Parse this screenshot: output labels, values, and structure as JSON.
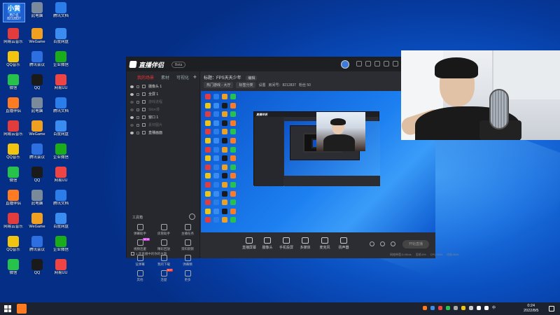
{
  "desktop": {
    "user_card": {
      "avatar": "小黄",
      "name": "用户名",
      "id": "8212837"
    },
    "icons": [
      {
        "label": "此电脑",
        "color": "#7b8a9a"
      },
      {
        "label": "腾讯文档",
        "color": "#2b7de9"
      },
      {
        "label": "网易云音乐",
        "color": "#e33c3c"
      },
      {
        "label": "WeGame",
        "color": "#f0a020"
      },
      {
        "label": "百度网盘",
        "color": "#3b8cf0"
      },
      {
        "label": "QQ音乐",
        "color": "#f1c40f"
      },
      {
        "label": "腾讯会议",
        "color": "#2d6fe0"
      },
      {
        "label": "企业微信",
        "color": "#1aad19"
      },
      {
        "label": "微信",
        "color": "#27c24c"
      },
      {
        "label": "QQ",
        "color": "#1a1a1a"
      },
      {
        "label": "网易UU",
        "color": "#e44"
      },
      {
        "label": "直播伴侣",
        "color": "#ff7b22"
      }
    ]
  },
  "app": {
    "logo_text": "直播伴侣",
    "beta_label": "Beta",
    "sidebar_tabs": [
      "我的场景",
      "素材",
      "可视化"
    ],
    "sources": [
      {
        "label": "摄像头 1",
        "dim": false
      },
      {
        "label": "全屏 1",
        "dim": false
      },
      {
        "label": "游戏进程",
        "dim": true
      },
      {
        "label": "Slice漫",
        "dim": true
      },
      {
        "label": "窗口 1",
        "dim": false
      },
      {
        "label": "素材图片",
        "dim": true
      },
      {
        "label": "直播画面",
        "dim": false
      }
    ],
    "tools_header": "工具箱",
    "tools": [
      {
        "label": "弹幕助手"
      },
      {
        "label": "房管助手"
      },
      {
        "label": "主播任务"
      },
      {
        "label": "视频连麽",
        "badge": "NEW"
      },
      {
        "label": "精彩回放"
      },
      {
        "label": "资料默默"
      },
      {
        "label": "设弹幕"
      },
      {
        "label": "我的下载"
      },
      {
        "label": "弹幕精"
      },
      {
        "label": "其他"
      },
      {
        "label": "连麽",
        "badge": "HOT"
      },
      {
        "label": "更多"
      }
    ],
    "footer_text": "1 连直播中的你的主题",
    "title_line": "标题：FPS天天少年",
    "edit_label": "编辑",
    "meta": [
      "热门游戏 - 大厅",
      "标签分类",
      "设置"
    ],
    "room_text": "房间号：8212837",
    "fans_text": "粉丝 50",
    "controls": [
      {
        "label": "直播屏幕"
      },
      {
        "label": "摄像头"
      },
      {
        "label": "手机投屏"
      },
      {
        "label": "多媒体"
      },
      {
        "label": "麦克风"
      },
      {
        "label": "扬声器"
      }
    ],
    "start_button": "开始直播",
    "stats": [
      "网络带宽:0.0Kb/s",
      "丢帧:0%",
      "CPU:10%",
      "内存:30%"
    ]
  },
  "taskbar": {
    "tray_text": "·",
    "clock_time": "0:24",
    "clock_date": "2022/8/5"
  }
}
